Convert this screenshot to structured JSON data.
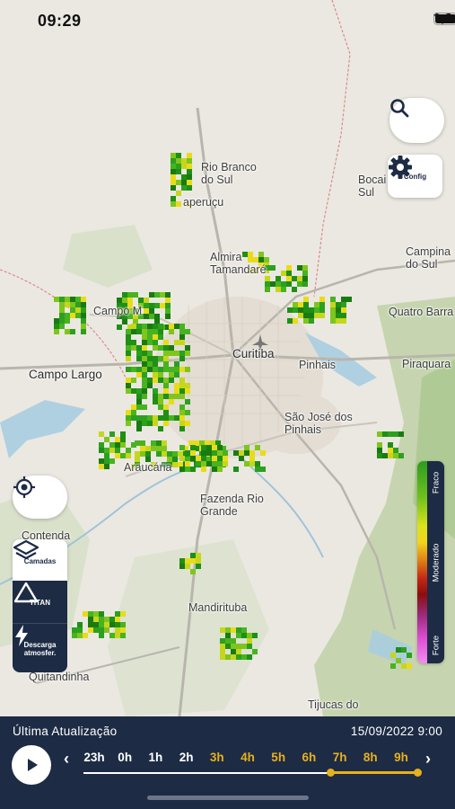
{
  "status_bar": {
    "time": "09:29"
  },
  "map": {
    "places": [
      {
        "key": "rio_branco",
        "text": "Rio Branco\ndo Sul"
      },
      {
        "key": "bocaiuva",
        "text": "Bocai\nSul"
      },
      {
        "key": "itaperucu",
        "text": "aperuçu"
      },
      {
        "key": "almirante",
        "text": "Almira\nTamandaré"
      },
      {
        "key": "campina",
        "text": "Campina\ndo Sul"
      },
      {
        "key": "quatro_barras",
        "text": "Quatro Barra"
      },
      {
        "key": "campo_magro",
        "text": "Campo M"
      },
      {
        "key": "curitiba",
        "text": "Curitiba"
      },
      {
        "key": "pinhais",
        "text": "Pinhais"
      },
      {
        "key": "piraquara",
        "text": "Piraquara"
      },
      {
        "key": "campo_largo",
        "text": "Campo Largo"
      },
      {
        "key": "sao_jose",
        "text": "São José dos\nPinhais"
      },
      {
        "key": "araucaria",
        "text": "Araucária"
      },
      {
        "key": "fazenda",
        "text": "Fazenda Rio\nGrande"
      },
      {
        "key": "contenda",
        "text": "Contenda"
      },
      {
        "key": "mandirituba",
        "text": "Mandirituba"
      },
      {
        "key": "quitandinha",
        "text": "Quitandinha"
      },
      {
        "key": "tijucas",
        "text": "Tijucas do"
      }
    ]
  },
  "controls": {
    "search_icon": "search-icon",
    "config_label": "Config",
    "layers_label": "Camadas",
    "titan_label": "TITAN",
    "descarga_label": "Descarga\natmosfer."
  },
  "legend": {
    "labels": [
      "Fraco",
      "Moderado",
      "Forte"
    ],
    "colors": [
      "#2b9c1e",
      "#d9e21a",
      "#c32816",
      "#e04fd5"
    ]
  },
  "timeline": {
    "label": "Última Atualização",
    "date": "15/09/2022 9:00",
    "hours": [
      "23h",
      "0h",
      "1h",
      "2h",
      "3h",
      "4h",
      "5h",
      "6h",
      "7h",
      "8h",
      "9h"
    ],
    "active_from": "7h",
    "active_to": "9h",
    "past_color": "#ffffff",
    "future_color": "#e6b01e"
  }
}
